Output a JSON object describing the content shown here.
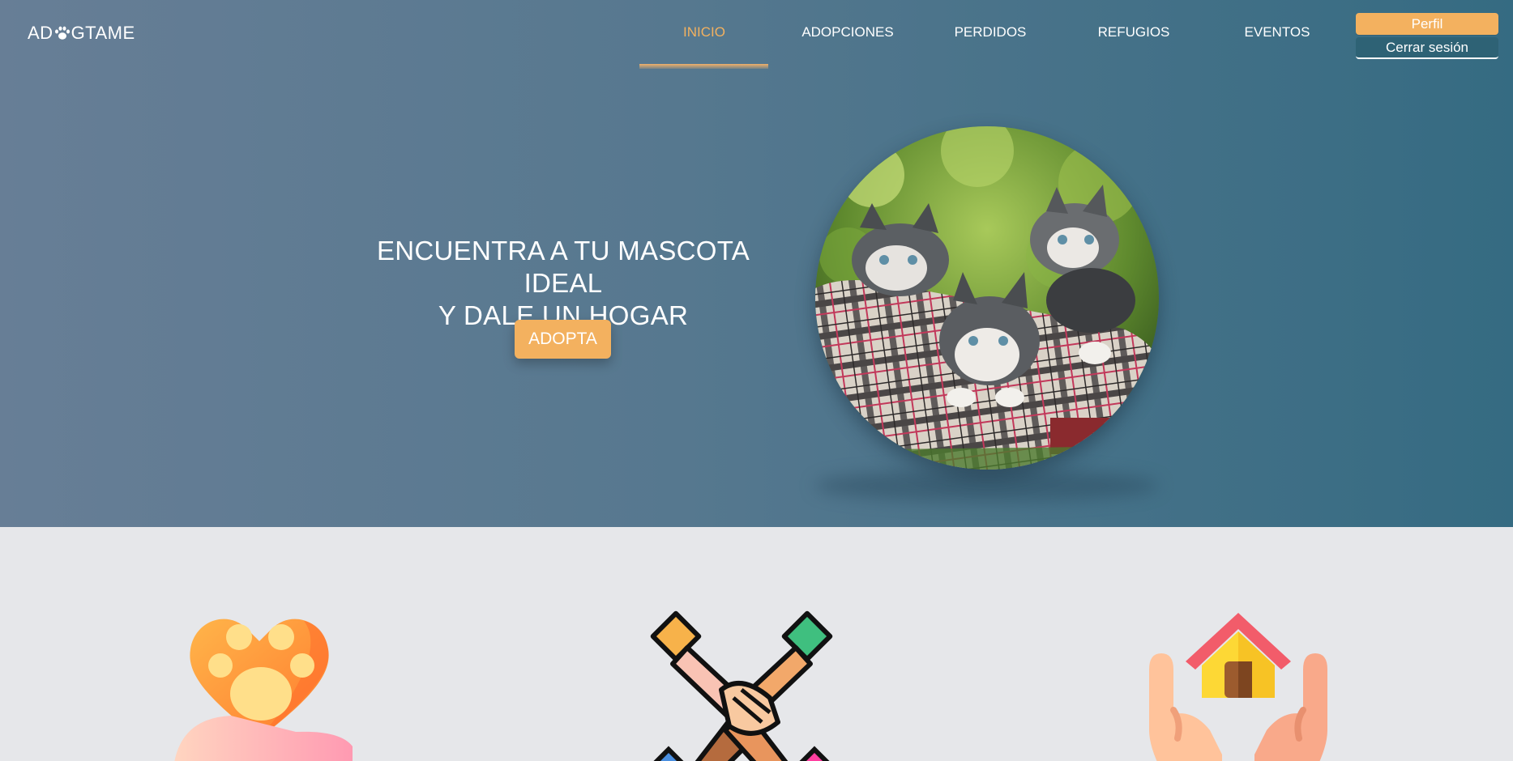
{
  "brand": {
    "text_before": "AD",
    "text_after": "GTAME",
    "icon": "paw-icon"
  },
  "nav": {
    "items": [
      {
        "label": "INICIO",
        "active": true
      },
      {
        "label": "ADOPCIONES",
        "active": false
      },
      {
        "label": "PERDIDOS",
        "active": false
      },
      {
        "label": "REFUGIOS",
        "active": false
      },
      {
        "label": "EVENTOS",
        "active": false
      }
    ]
  },
  "account": {
    "profile_label": "Perfil",
    "logout_label": "Cerrar sesión"
  },
  "hero": {
    "title_line1": "ENCUENTRA A TU MASCOTA IDEAL",
    "title_line2": "Y DALE UN HOGAR",
    "cta_label": "ADOPTA",
    "image": "kittens-in-plaid-basket"
  },
  "features": [
    {
      "icon": "paw-heart-hand-icon"
    },
    {
      "icon": "hands-together-icon"
    },
    {
      "icon": "house-in-hands-icon"
    }
  ],
  "colors": {
    "accent": "#f3b15f",
    "hero_left": "#677e96",
    "hero_right": "#356b82",
    "logout_bg": "#2e6275",
    "page_bg": "#e6e7ea"
  }
}
